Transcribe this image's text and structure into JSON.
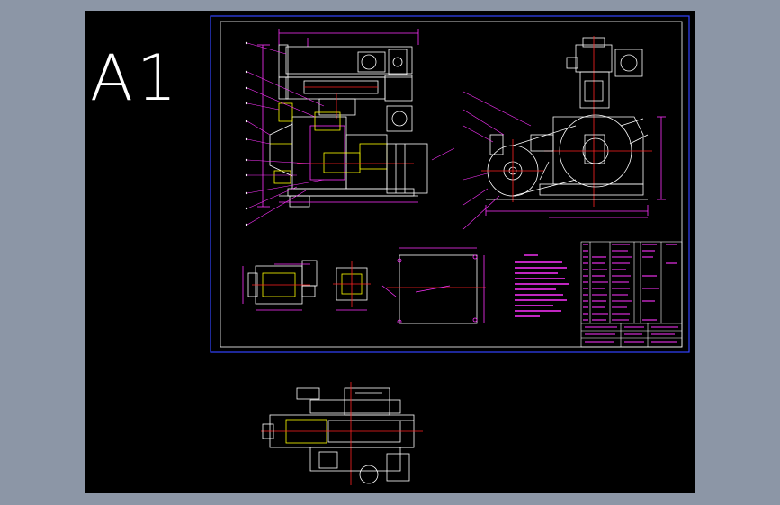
{
  "sheet": {
    "label": "A1",
    "background_color": "#000000",
    "frame_color": "#3344ff",
    "inner_frame_color": "#ffffff"
  },
  "views": [
    {
      "name": "front-elevation"
    },
    {
      "name": "side-elevation"
    },
    {
      "name": "detail-views"
    },
    {
      "name": "foundation-plan"
    },
    {
      "name": "technical-requirements"
    },
    {
      "name": "parts-list-title-block"
    },
    {
      "name": "top-view-outside-frame"
    }
  ],
  "colors": {
    "geometry": "#ffffff",
    "dimensions": "#ff33ff",
    "centerlines": "#ff2222",
    "highlight": "#ffff00",
    "text": "#ff33ff",
    "table_lines": "#ffffff"
  }
}
